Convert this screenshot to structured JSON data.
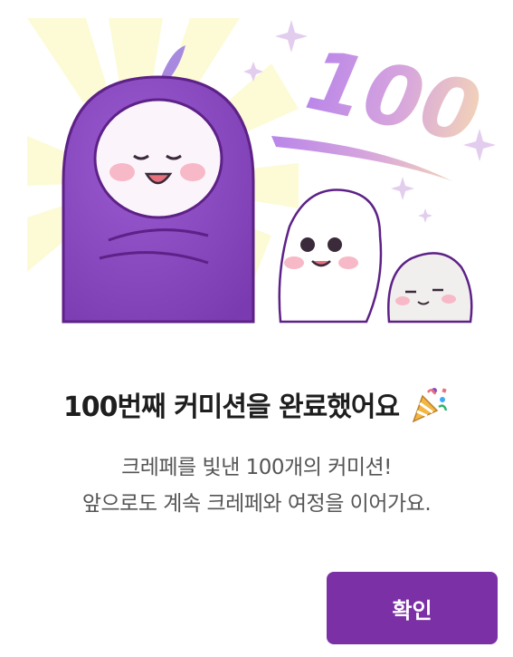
{
  "colors": {
    "accent": "#7b30a6",
    "mascot_purple": "#8a4bbf",
    "title_text": "#1e1e1e",
    "body_text": "#555555",
    "button_text": "#ffffff"
  },
  "illustration": {
    "badge_text": "100",
    "characters": [
      "purple-mascot",
      "white-cream-mascot",
      "gray-mascot"
    ]
  },
  "dialog": {
    "title": "100번째 커미션을 완료했어요",
    "title_icon": "party-popper-icon",
    "description_line1": "크레페를 빛낸 100개의 커미션!",
    "description_line2": "앞으로도 계속 크레페와 여정을 이어가요.",
    "confirm_label": "확인"
  }
}
